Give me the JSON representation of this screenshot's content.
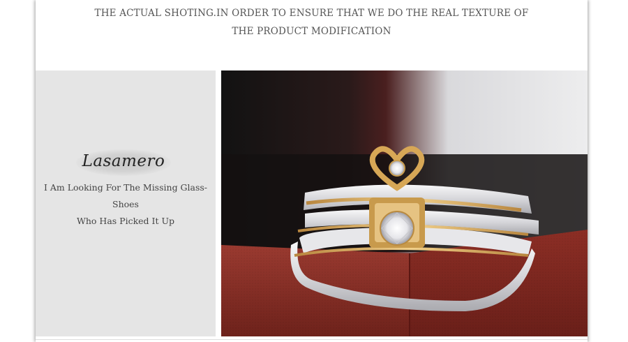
{
  "header": {
    "line1": "THE ACTUAL SHOTING.IN ORDER TO ENSURE THAT WE DO THE REAL TEXTURE OF",
    "line2": "THE PRODUCT MODIFICATION"
  },
  "brand_panel": {
    "brand_name": "Lasamero",
    "tagline_line1": "I Am Looking For The Missing Glass-Shoes",
    "tagline_line2": "Who Has Picked It Up"
  },
  "colors": {
    "panel_bg": "#e5e5e5",
    "gold": "#d4a85a",
    "silver": "#e8e8ea",
    "box_red": "#8e2f26"
  },
  "photo": {
    "icon": "rings-photo"
  }
}
